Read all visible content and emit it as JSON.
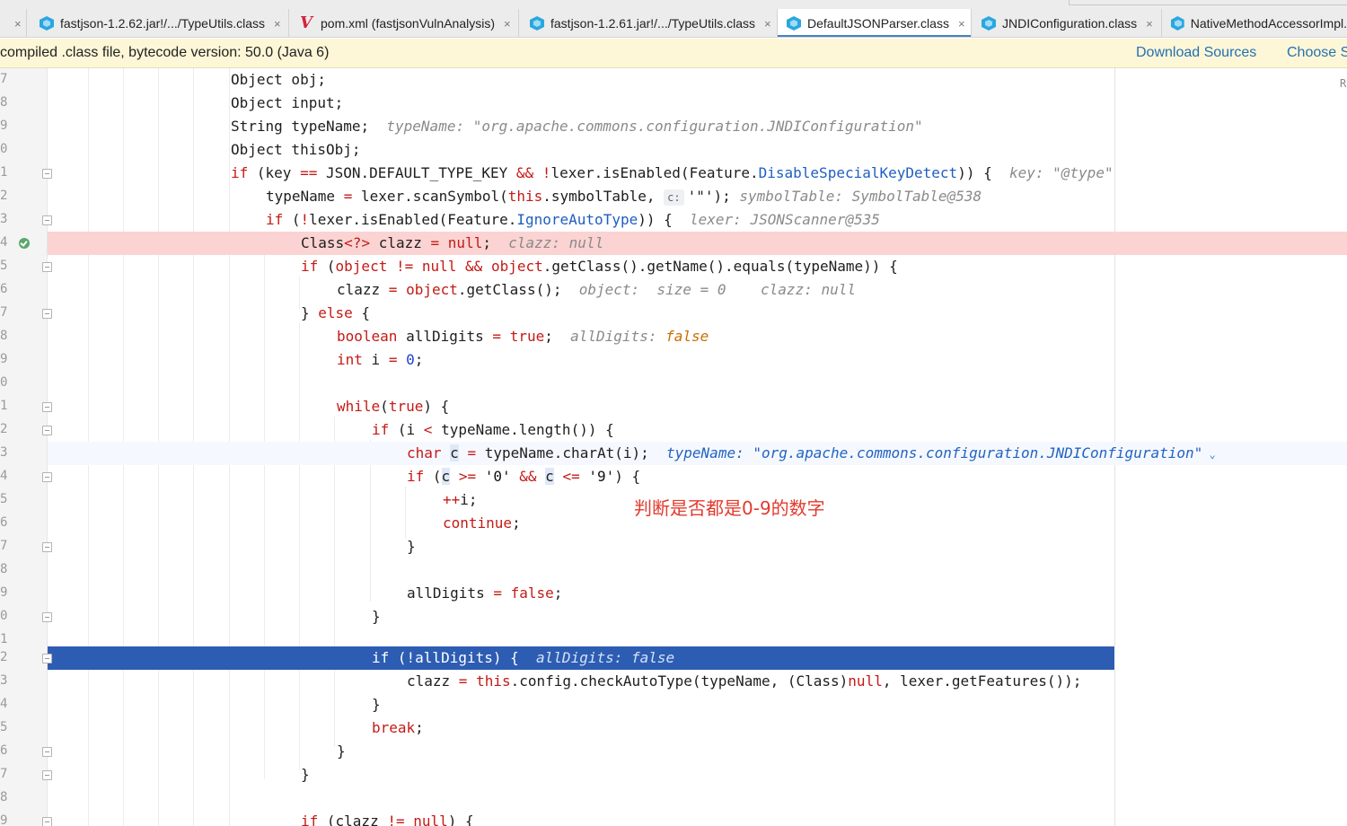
{
  "tabs": [
    {
      "label": "",
      "icon": "close-icon"
    },
    {
      "label": "fastjson-1.2.62.jar!/.../TypeUtils.class",
      "icon": "class-file-icon"
    },
    {
      "label": "pom.xml (fastjsonVulnAnalysis)",
      "icon": "maven-icon"
    },
    {
      "label": "fastjson-1.2.61.jar!/.../TypeUtils.class",
      "icon": "class-file-icon"
    },
    {
      "label": "DefaultJSONParser.class",
      "icon": "class-file-icon",
      "active": true
    },
    {
      "label": "JNDIConfiguration.class",
      "icon": "class-file-icon"
    },
    {
      "label": "NativeMethodAccessorImpl.",
      "icon": "class-file-icon"
    }
  ],
  "tab_close": "×",
  "banner": {
    "message": "compiled .class file, bytecode version: 50.0 (Java 6)",
    "download_sources": "Download Sources",
    "choose_sources": "Choose S"
  },
  "reader_mode_label": "R",
  "annotation": "判断是否都是0-9的数字",
  "line_numbers": [
    "7",
    "8",
    "9",
    "0",
    "1",
    "2",
    "3",
    "4",
    "5",
    "6",
    "7",
    "8",
    "9",
    "0",
    "1",
    "2",
    "3",
    "4",
    "5",
    "6",
    "7",
    "8",
    "9",
    "0",
    "1",
    "2",
    "3",
    "4",
    "5",
    "6",
    "7",
    "8",
    "9"
  ],
  "code_hints": {
    "typeName": "typeName: \"org.apache.commons.configuration.JNDIConfiguration\"",
    "key": "key: \"@type\"",
    "symbolTable": "symbolTable: SymbolTable@538",
    "lexer": "lexer: JSONScanner@535",
    "clazz_null": "clazz: null",
    "object_size": "object:  size = 0",
    "allDigits_label": "allDigits: ",
    "allDigits_value": "false",
    "typeName_label": "typeName: ",
    "typeName_value": "\"org.apache.commons.configuration.JNDIConfiguration\"",
    "allDigits_exec": "allDigits: false",
    "chip": "c:"
  }
}
